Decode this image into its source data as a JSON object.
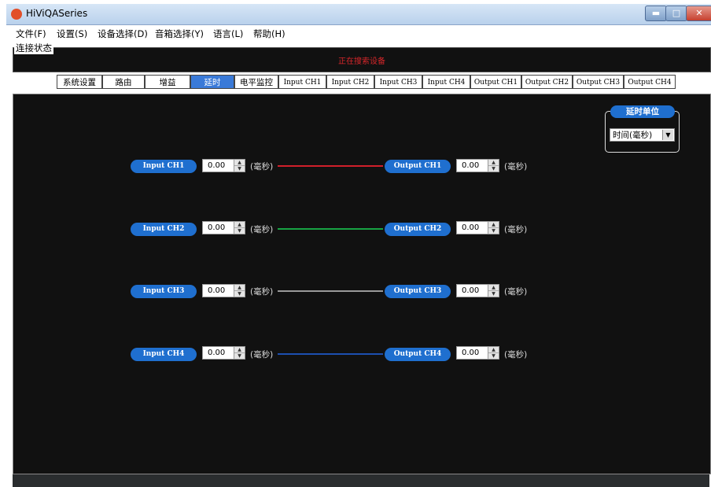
{
  "window": {
    "title": "HiViQASeries",
    "min_glyph": "▬",
    "max_glyph": "□",
    "close_glyph": "✕"
  },
  "menu": [
    "文件(F)",
    "设置(S)",
    "设备选择(D)",
    "音箱选择(Y)",
    "语言(L)",
    "帮助(H)"
  ],
  "connection": {
    "label": "连接状态",
    "status": "正在搜索设备"
  },
  "tabs": [
    "系统设置",
    "路由",
    "增益",
    "延时",
    "电平监控",
    "Input CH1",
    "Input CH2",
    "Input CH3",
    "Input CH4",
    "Output CH1",
    "Output CH2",
    "Output CH3",
    "Output CH4"
  ],
  "active_tab": "延时",
  "delay_unit": {
    "title": "延时单位",
    "selected": "时间(毫秒)"
  },
  "channels": [
    {
      "input": "Input CH1",
      "input_delay": "0.00",
      "output": "Output CH1",
      "output_delay": "0.00",
      "unit": "(毫秒)",
      "color": "#d11f2a"
    },
    {
      "input": "Input CH2",
      "input_delay": "0.00",
      "output": "Output CH2",
      "output_delay": "0.00",
      "unit": "(毫秒)",
      "color": "#18a344"
    },
    {
      "input": "Input CH3",
      "input_delay": "0.00",
      "output": "Output CH3",
      "output_delay": "0.00",
      "unit": "(毫秒)",
      "color": "#9a9a9a"
    },
    {
      "input": "Input CH4",
      "input_delay": "0.00",
      "output": "Output CH4",
      "output_delay": "0.00",
      "unit": "(毫秒)",
      "color": "#1d4fb0"
    }
  ],
  "colors": {
    "accent": "#1f6fcf",
    "status_text": "#d6262a",
    "panel_bg": "#111111"
  }
}
